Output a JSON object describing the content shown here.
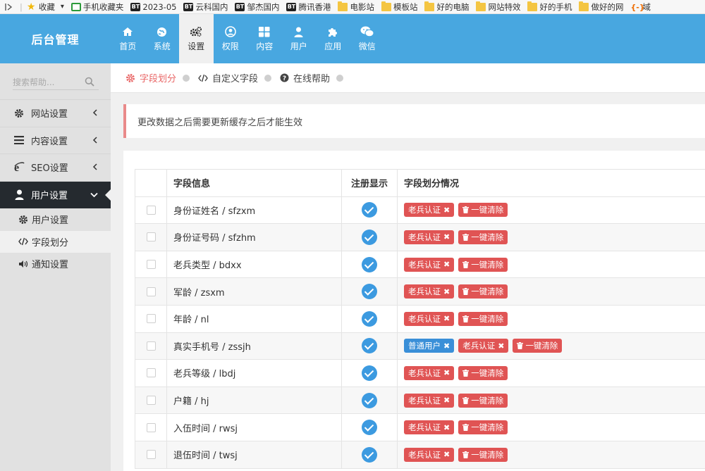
{
  "bookmarks": [
    {
      "icon": "star-icon",
      "label": "收藏"
    },
    {
      "icon": "phone-icon",
      "label": "手机收藏夹"
    },
    {
      "icon": "bt-icon",
      "label": "2023-05"
    },
    {
      "icon": "bt-icon",
      "label": "云科国内"
    },
    {
      "icon": "bt-icon",
      "label": "邹杰国内"
    },
    {
      "icon": "bt-icon",
      "label": "腾讯香港"
    },
    {
      "icon": "folder-icon",
      "label": "电影站"
    },
    {
      "icon": "folder-icon",
      "label": "模板站"
    },
    {
      "icon": "folder-icon",
      "label": "好的电脑"
    },
    {
      "icon": "folder-icon",
      "label": "网站特效"
    },
    {
      "icon": "folder-icon",
      "label": "好的手机"
    },
    {
      "icon": "folder-icon",
      "label": "做好的网"
    },
    {
      "icon": "bracket-icon",
      "label": "域"
    }
  ],
  "header": {
    "brand": "后台管理",
    "nav": [
      {
        "id": "home",
        "icon": "home-icon",
        "label": "首页"
      },
      {
        "id": "system",
        "icon": "globe-icon",
        "label": "系统"
      },
      {
        "id": "settings",
        "icon": "gears-icon",
        "label": "设置",
        "active": true
      },
      {
        "id": "permission",
        "icon": "user-circle-icon",
        "label": "权限"
      },
      {
        "id": "content",
        "icon": "grid-icon",
        "label": "内容"
      },
      {
        "id": "users",
        "icon": "user-icon",
        "label": "用户"
      },
      {
        "id": "apps",
        "icon": "puzzle-icon",
        "label": "应用"
      },
      {
        "id": "wechat",
        "icon": "wechat-icon",
        "label": "微信"
      }
    ]
  },
  "sidebar": {
    "search_placeholder": "搜索帮助...",
    "groups": [
      {
        "label": "网站设置",
        "icon": "gear-icon"
      },
      {
        "label": "内容设置",
        "icon": "bars-icon"
      },
      {
        "label": "SEO设置",
        "icon": "ie-icon"
      },
      {
        "label": "用户设置",
        "icon": "user-icon",
        "open": true
      }
    ],
    "submenu": [
      {
        "label": "用户设置",
        "icon": "gear-icon"
      },
      {
        "label": "字段划分",
        "icon": "code-icon",
        "active": true
      },
      {
        "label": "通知设置",
        "icon": "volume-icon"
      }
    ]
  },
  "tabs": [
    {
      "label": "字段划分",
      "icon": "gear-icon",
      "active": true
    },
    {
      "label": "自定义字段",
      "icon": "code-icon"
    },
    {
      "label": "在线帮助",
      "icon": "question-icon"
    }
  ],
  "alert": "更改数据之后需要更新缓存之后才能生效",
  "table": {
    "headers": {
      "info": "字段信息",
      "register": "注册显示",
      "division": "字段划分情况"
    },
    "tag_labels": {
      "veteran": "老兵认证",
      "normal": "普通用户",
      "clear": "一键清除"
    },
    "rows": [
      {
        "info": "身份证姓名 / sfzxm",
        "normal": false
      },
      {
        "info": "身份证号码 / sfzhm",
        "normal": false
      },
      {
        "info": "老兵类型 / bdxx",
        "normal": false
      },
      {
        "info": "军龄 / zsxm",
        "normal": false
      },
      {
        "info": "年龄 / nl",
        "normal": false
      },
      {
        "info": "真实手机号 / zssjh",
        "normal": true
      },
      {
        "info": "老兵等级 / lbdj",
        "normal": false
      },
      {
        "info": "户籍 / hj",
        "normal": false
      },
      {
        "info": "入伍时间 / rwsj",
        "normal": false
      },
      {
        "info": "退伍时间 / twsj",
        "normal": false
      }
    ]
  },
  "colors": {
    "header": "#48a7e0",
    "tag_red": "#e05454",
    "tag_blue": "#3a8fd8",
    "check": "#3c9ae0",
    "active_tab": "#e96868"
  }
}
